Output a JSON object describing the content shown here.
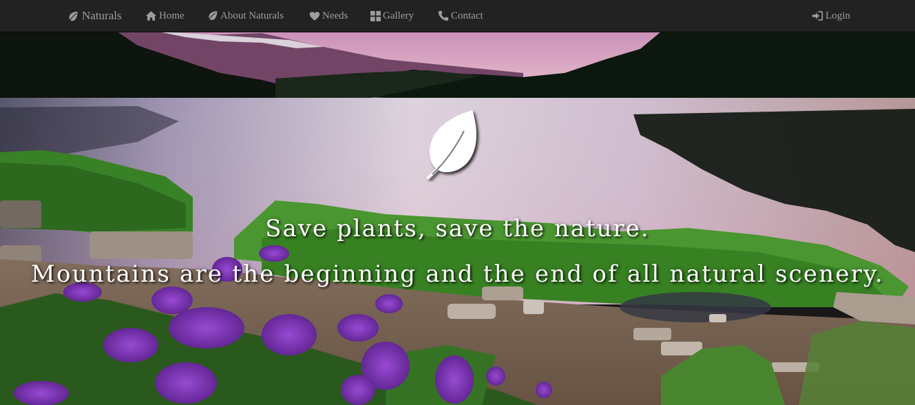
{
  "navbar": {
    "brand": {
      "label": "Naturals",
      "icon": "leaf-icon"
    },
    "links": {
      "home": {
        "label": "Home",
        "icon": "home-icon"
      },
      "about": {
        "label": "About Naturals",
        "icon": "leaf-icon"
      },
      "needs": {
        "label": "Needs",
        "icon": "heart-icon"
      },
      "gallery": {
        "label": "Gallery",
        "icon": "grid-icon"
      },
      "contact": {
        "label": "Contact",
        "icon": "phone-icon"
      }
    },
    "login": {
      "label": "Login",
      "icon": "login-icon"
    }
  },
  "hero": {
    "logo_icon": "leaf-icon",
    "line1": "Save plants, save the nature.",
    "line2": "Mountains are the beginning and the end of all natural scenery."
  },
  "colors": {
    "navbar_bg": "#222222",
    "nav_text": "#9d9d9d",
    "hero_text": "#ffffff",
    "flowers": "#8b3fd0"
  }
}
